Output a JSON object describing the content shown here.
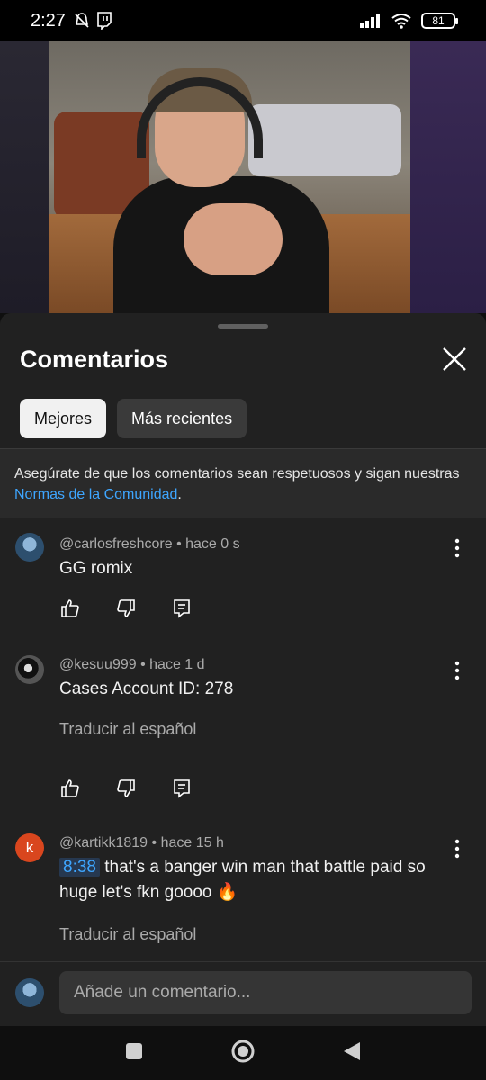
{
  "status_bar": {
    "time": "2:27",
    "battery": "81"
  },
  "panel": {
    "title": "Comentarios",
    "chips": [
      {
        "label": "Mejores",
        "active": true
      },
      {
        "label": "Más recientes",
        "active": false
      }
    ],
    "notice_text": "Asegúrate de que los comentarios sean respetuosos y sigan nuestras ",
    "notice_link": "Normas de la Comunidad",
    "notice_end": "."
  },
  "comments": [
    {
      "author": "@carlosfreshcore",
      "time": "hace 0 s",
      "text": "GG romix",
      "translate": ""
    },
    {
      "author": "@kesuu999",
      "time": "hace 1 d",
      "text": "Cases Account ID: 278",
      "translate": "Traducir al español"
    },
    {
      "author": "@kartikk1819",
      "time": "hace 15 h",
      "avatar_letter": "k",
      "timestamp": "8:38",
      "text": " that's a banger win man that battle paid so huge let's fkn goooo 🔥",
      "translate": "Traducir al español"
    }
  ],
  "add_comment": {
    "placeholder": "Añade un comentario..."
  },
  "colors": {
    "accent_link": "#3ea6ff",
    "background": "#0f0f0f",
    "panel": "#212121"
  }
}
